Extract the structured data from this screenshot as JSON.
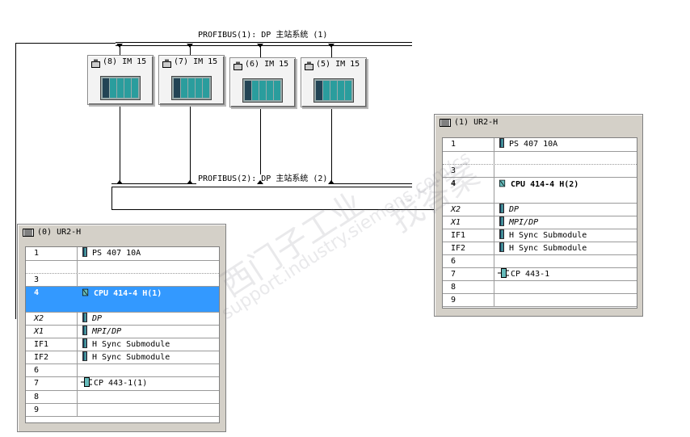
{
  "buses": {
    "bus1_label": "PROFIBUS(1): DP 主站系统 (1)",
    "bus2_label": "PROFIBUS(2): DP 主站系统 (2)"
  },
  "stations": [
    {
      "label": "(8) IM 15"
    },
    {
      "label": "(7) IM 15"
    },
    {
      "label": "(6) IM 15"
    },
    {
      "label": "(5) IM 15"
    }
  ],
  "rack0": {
    "title": "(0) UR2-H",
    "rows": [
      {
        "slot": "1",
        "module": "PS 407 10A",
        "icon": "module-icon"
      },
      {
        "slot": "3",
        "module": "",
        "icon": ""
      },
      {
        "slot": "4",
        "module": "CPU 414-4 H(1)",
        "icon": "cpu-icon",
        "selected": true
      },
      {
        "slot": "X2",
        "module": "DP",
        "icon": "module-icon"
      },
      {
        "slot": "X1",
        "module": "MPI/DP",
        "icon": "module-icon"
      },
      {
        "slot": "IF1",
        "module": "H Sync Submodule",
        "icon": "module-icon"
      },
      {
        "slot": "IF2",
        "module": "H Sync Submodule",
        "icon": "module-icon"
      },
      {
        "slot": "6",
        "module": "",
        "icon": ""
      },
      {
        "slot": "7",
        "module": "CP 443-1(1)",
        "icon": "network-module-icon"
      },
      {
        "slot": "8",
        "module": "",
        "icon": ""
      },
      {
        "slot": "9",
        "module": "",
        "icon": ""
      }
    ]
  },
  "rack1": {
    "title": "(1) UR2-H",
    "rows": [
      {
        "slot": "1",
        "module": "PS 407 10A",
        "icon": "module-icon"
      },
      {
        "slot": "3",
        "module": "",
        "icon": ""
      },
      {
        "slot": "4",
        "module": "CPU 414-4 H(2)",
        "icon": "cpu-icon"
      },
      {
        "slot": "X2",
        "module": "DP",
        "icon": "module-icon"
      },
      {
        "slot": "X1",
        "module": "MPI/DP",
        "icon": "module-icon"
      },
      {
        "slot": "IF1",
        "module": "H Sync Submodule",
        "icon": "module-icon"
      },
      {
        "slot": "IF2",
        "module": "H Sync Submodule",
        "icon": "module-icon"
      },
      {
        "slot": "6",
        "module": "",
        "icon": ""
      },
      {
        "slot": "7",
        "module": "CP 443-1",
        "icon": "network-module-icon"
      },
      {
        "slot": "8",
        "module": "",
        "icon": ""
      },
      {
        "slot": "9",
        "module": "",
        "icon": ""
      }
    ]
  },
  "watermark": {
    "text1": "西门子工业",
    "text2": "support.industry.siemens.com/cs",
    "text3": "找答案"
  },
  "colors": {
    "selection": "#3399ff",
    "rack_bg": "#d4d0c8"
  }
}
